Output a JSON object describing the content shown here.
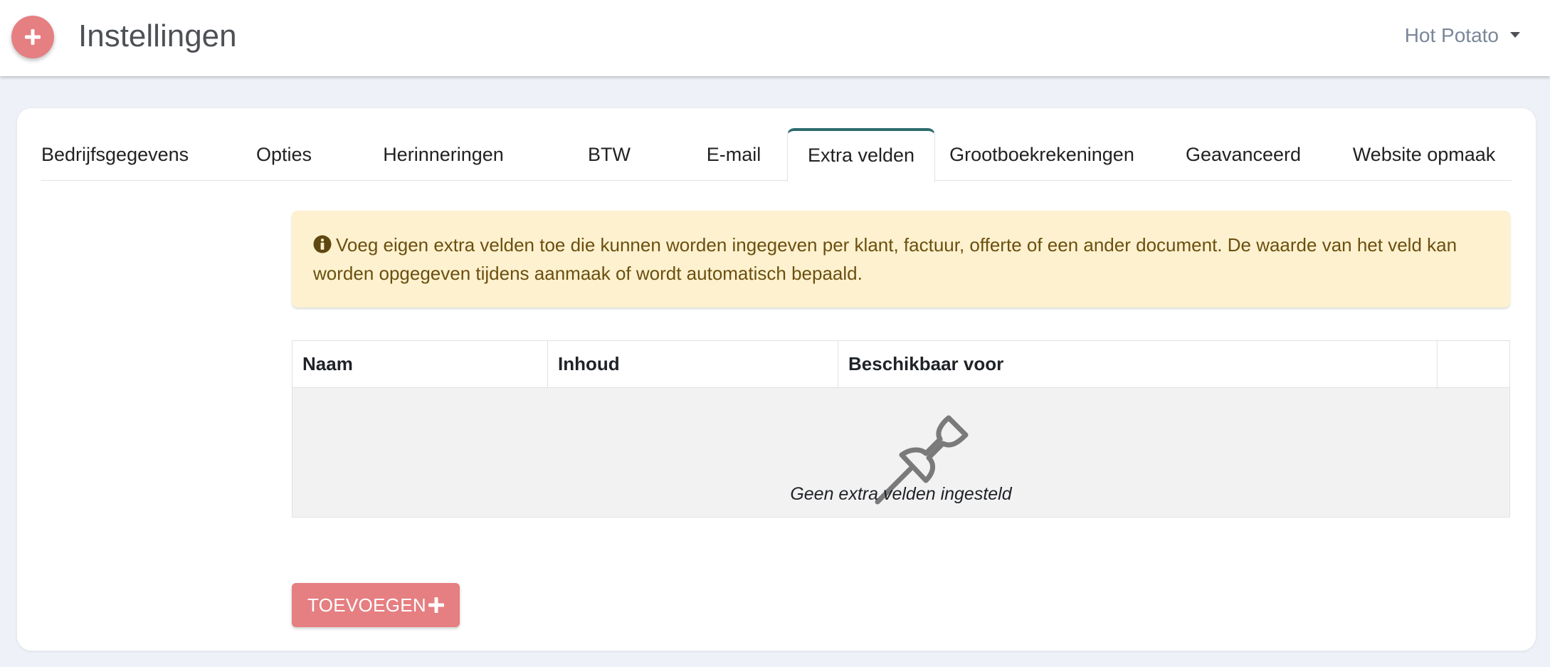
{
  "header": {
    "title": "Instellingen",
    "account_name": "Hot Potato",
    "add_button_icon": "plus-icon",
    "accent_color": "#e57f81"
  },
  "tabs": [
    {
      "label": "Bedrijfsgegevens",
      "active": false
    },
    {
      "label": "Opties",
      "active": false
    },
    {
      "label": "Herinneringen",
      "active": false
    },
    {
      "label": "BTW",
      "active": false
    },
    {
      "label": "E-mail",
      "active": false
    },
    {
      "label": "Extra velden",
      "active": true
    },
    {
      "label": "Grootboekrekeningen",
      "active": false
    },
    {
      "label": "Geavanceerd",
      "active": false
    },
    {
      "label": "Website opmaak",
      "active": false
    }
  ],
  "info_alert": {
    "icon": "info-circle-icon",
    "text": "Voeg eigen extra velden toe die kunnen worden ingegeven per klant, factuur, offerte of een ander document. De waarde van het veld kan worden opgegeven tijdens aanmaak of wordt automatisch bepaald."
  },
  "fields_table": {
    "columns": [
      "Naam",
      "Inhoud",
      "Beschikbaar voor",
      ""
    ],
    "rows": [],
    "empty_icon": "pushpin-icon",
    "empty_text": "Geen extra velden ingesteld"
  },
  "add_button": {
    "label": "TOEVOEGEN",
    "icon": "plus-icon"
  }
}
